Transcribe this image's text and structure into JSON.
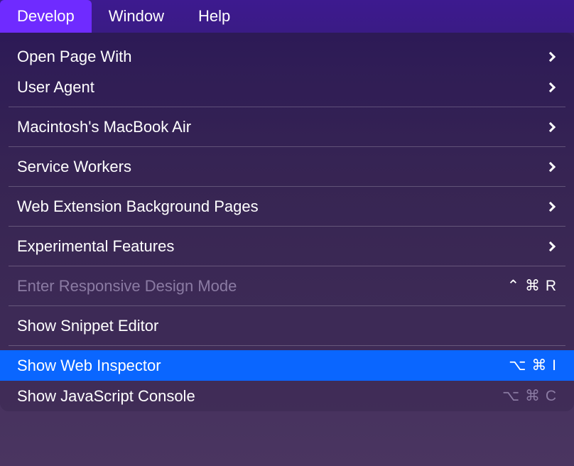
{
  "menubar": {
    "items": [
      {
        "label": "Develop",
        "active": true
      },
      {
        "label": "Window",
        "active": false
      },
      {
        "label": "Help",
        "active": false
      }
    ]
  },
  "dropdown": {
    "groups": [
      [
        {
          "label": "Open Page With",
          "submenu": true
        },
        {
          "label": "User Agent",
          "submenu": true
        }
      ],
      [
        {
          "label": "Macintosh's MacBook Air",
          "submenu": true
        }
      ],
      [
        {
          "label": "Service Workers",
          "submenu": true
        }
      ],
      [
        {
          "label": "Web Extension Background Pages",
          "submenu": true
        }
      ],
      [
        {
          "label": "Experimental Features",
          "submenu": true
        }
      ],
      [
        {
          "label": "Enter Responsive Design Mode",
          "disabled": true,
          "shortcut": "⌃ ⌘ R"
        }
      ],
      [
        {
          "label": "Show Snippet Editor"
        }
      ],
      [
        {
          "label": "Show Web Inspector",
          "selected": true,
          "shortcut": "⌥ ⌘ I"
        },
        {
          "label": "Show JavaScript Console",
          "dimmed": true,
          "shortcut": "⌥ ⌘ C"
        }
      ]
    ]
  }
}
